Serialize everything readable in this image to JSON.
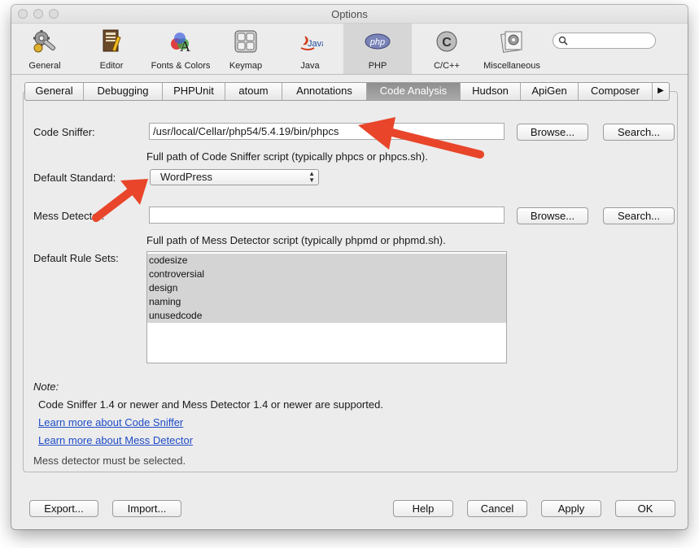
{
  "window": {
    "title": "Options"
  },
  "toolbar": {
    "items": [
      {
        "label": "General",
        "icon": "gear-wrench-icon"
      },
      {
        "label": "Editor",
        "icon": "editor-icon"
      },
      {
        "label": "Fonts & Colors",
        "icon": "fonts-colors-icon"
      },
      {
        "label": "Keymap",
        "icon": "keyboard-icon"
      },
      {
        "label": "Java",
        "icon": "java-icon",
        "icon_text": "Java"
      },
      {
        "label": "PHP",
        "icon": "php-icon",
        "icon_text": "php",
        "selected": true
      },
      {
        "label": "C/C++",
        "icon": "cpp-icon"
      },
      {
        "label": "Miscellaneous",
        "icon": "miscellaneous-icon"
      }
    ],
    "search": {
      "placeholder": "",
      "icon": "search-icon"
    }
  },
  "tabs": [
    {
      "label": "General"
    },
    {
      "label": "Debugging"
    },
    {
      "label": "PHPUnit"
    },
    {
      "label": "atoum"
    },
    {
      "label": "Annotations"
    },
    {
      "label": "Code Analysis",
      "active": true
    },
    {
      "label": "Hudson"
    },
    {
      "label": "ApiGen"
    },
    {
      "label": "Composer"
    }
  ],
  "tabs_overflow_icon": "triangle-right-icon",
  "code_sniffer": {
    "label": "Code Sniffer:",
    "value": "/usr/local/Cellar/php54/5.4.19/bin/phpcs",
    "browse": "Browse...",
    "search": "Search...",
    "hint": "Full path of Code Sniffer script (typically phpcs or phpcs.sh)."
  },
  "default_standard": {
    "label": "Default Standard:",
    "value": "WordPress"
  },
  "mess_detector": {
    "label": "Mess Detector:",
    "value": "",
    "browse": "Browse...",
    "search": "Search...",
    "hint": "Full path of Mess Detector script (typically phpmd or phpmd.sh)."
  },
  "rule_sets": {
    "label": "Default Rule Sets:",
    "items": [
      "codesize",
      "controversial",
      "design",
      "naming",
      "unusedcode"
    ]
  },
  "note": {
    "title": "Note:",
    "text": "Code Sniffer 1.4 or newer and Mess Detector 1.4 or newer are supported.",
    "link1": "Learn more about Code Sniffer",
    "link2": "Learn more about Mess Detector",
    "status": "Mess detector must be selected."
  },
  "footer": {
    "export": "Export...",
    "import": "Import...",
    "help": "Help",
    "cancel": "Cancel",
    "apply": "Apply",
    "ok": "OK"
  },
  "colors": {
    "arrow": "#e8452a",
    "link": "#1f4cc7",
    "active_tab": "#9a9a9a",
    "list_selection": "#d4d4d4"
  }
}
